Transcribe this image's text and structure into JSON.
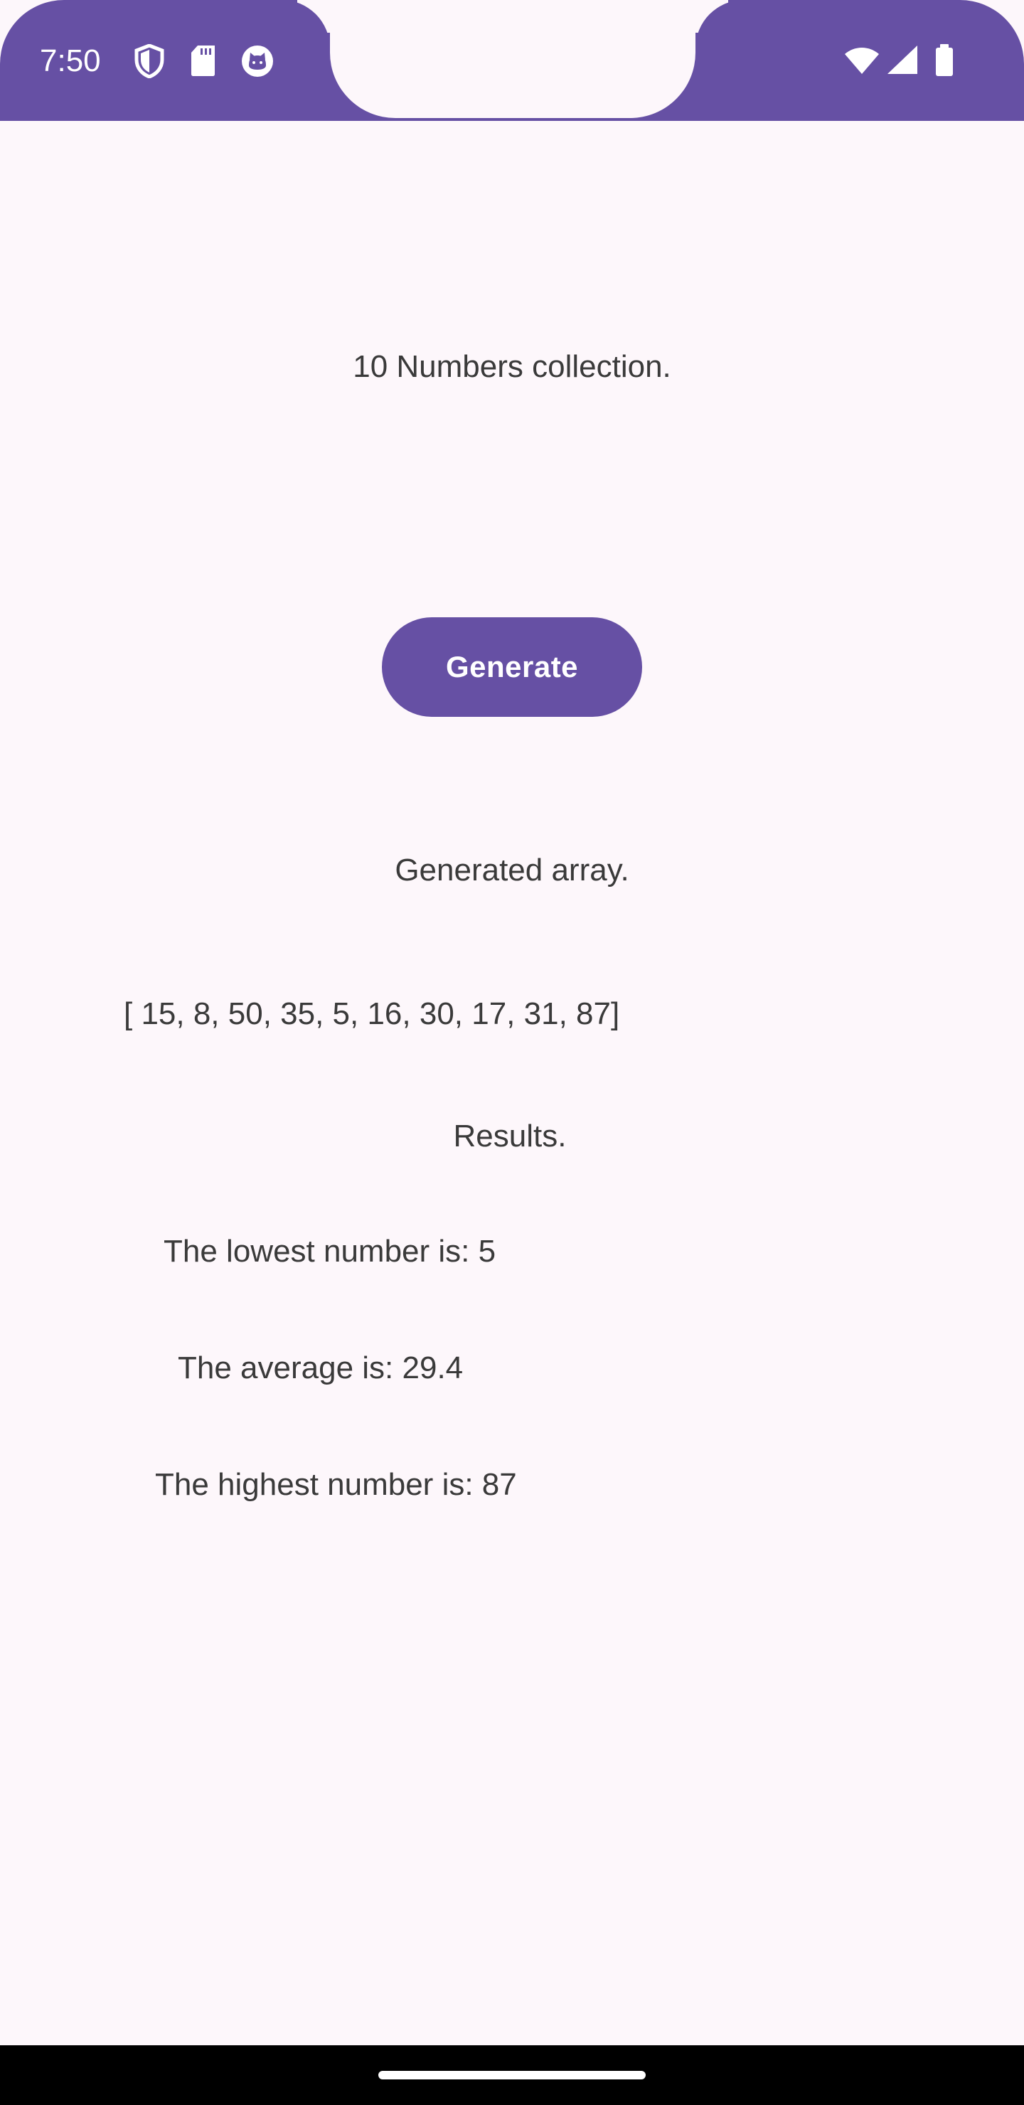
{
  "status_bar": {
    "time": "7:50",
    "background_color": "#6650a4",
    "left_icons": [
      "shield-icon",
      "sdcard-icon",
      "cat-icon"
    ],
    "right_icons": [
      "wifi-icon",
      "signal-icon",
      "battery-icon"
    ]
  },
  "main": {
    "title": "10 Numbers collection.",
    "generate_label": "Generate",
    "generated_label": "Generated array.",
    "array_text": "[ 15, 8, 50, 35, 5, 16, 30, 17, 31, 87]",
    "results_label": "Results.",
    "lowest_text": "The lowest number is: 5",
    "average_text": "The average is: 29.4",
    "highest_text": "The highest number is: 87"
  },
  "colors": {
    "accent": "#6650a4",
    "background": "#fdf7fb",
    "text": "#3a3a3a"
  }
}
